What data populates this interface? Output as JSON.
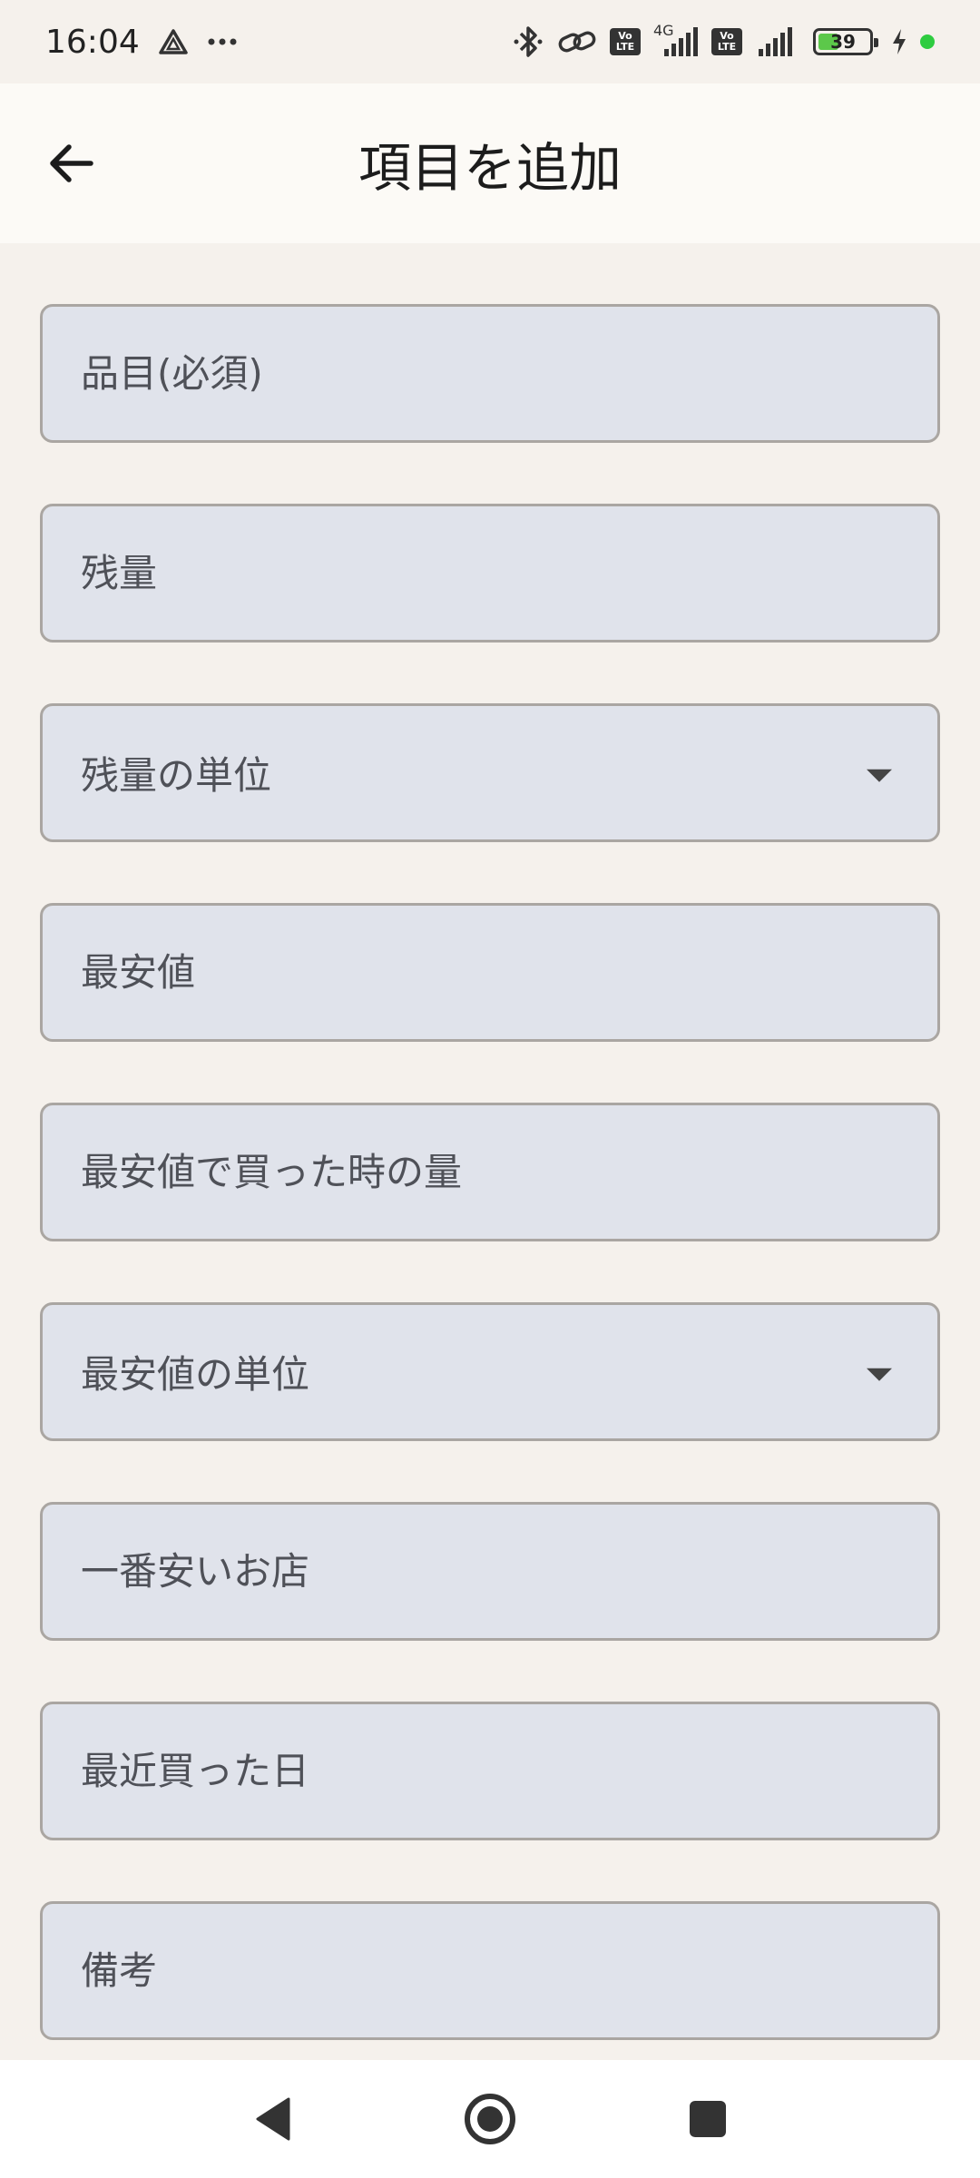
{
  "status_bar": {
    "time": "16:04",
    "battery_level": "39",
    "network": "4G",
    "icons": [
      "drive-icon",
      "more-dots-icon",
      "bluetooth-icon",
      "link-icon",
      "volte-icon",
      "signal-icon",
      "volte-icon",
      "signal-icon",
      "battery-icon",
      "charging-icon"
    ]
  },
  "app_bar": {
    "title": "項目を追加",
    "back_icon": "arrow-back-icon"
  },
  "form": {
    "item_name_placeholder": "品目(必須)",
    "remaining_amount_placeholder": "残量",
    "remaining_unit_label": "残量の単位",
    "lowest_price_placeholder": "最安値",
    "lowest_price_quantity_placeholder": "最安値で買った時の量",
    "lowest_price_unit_label": "最安値の単位",
    "cheapest_store_placeholder": "一番安いお店",
    "last_purchase_date_placeholder": "最近買った日",
    "notes_placeholder": "備考"
  },
  "nav_bar": {
    "icons": [
      "nav-back-icon",
      "nav-home-icon",
      "nav-recents-icon"
    ]
  }
}
